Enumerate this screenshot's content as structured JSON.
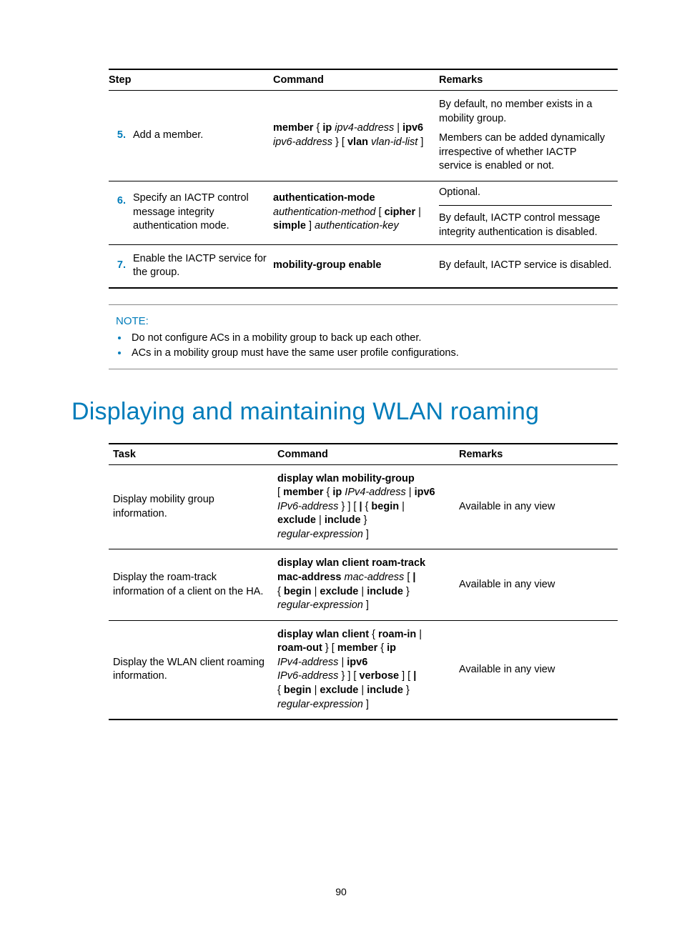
{
  "table1": {
    "headers": {
      "step": "Step",
      "command": "Command",
      "remarks": "Remarks"
    },
    "rows": [
      {
        "num": "5.",
        "desc": "Add a member.",
        "cmd": {
          "p1b": "member",
          "p1": " { ",
          "p2b": "ip",
          "p2i": " ipv4-address",
          "p3": " | ",
          "p3b": "ipv6",
          "p4i": "ipv6-address",
          "p4": " } [ ",
          "p5b": "vlan",
          "p5i": " vlan-id-list",
          "p6": " ]"
        },
        "rem1": "By default, no member exists in a mobility group.",
        "rem2": "Members can be added dynamically irrespective of whether IACTP service is enabled or not."
      },
      {
        "num": "6.",
        "desc": "Specify an IACTP control message integrity authentication mode.",
        "cmd": {
          "l1b": "authentication-mode",
          "l2i": "authentication-method",
          "l2": " [ ",
          "l2b1": "cipher",
          "l2s": " | ",
          "l3b": "simple",
          "l3": " ] ",
          "l3i": "authentication-key"
        },
        "rem_top": "Optional.",
        "rem_bot": "By default, IACTP control message integrity authentication is disabled."
      },
      {
        "num": "7.",
        "desc": "Enable the IACTP service for the group.",
        "cmd": {
          "b": "mobility-group enable"
        },
        "rem": "By default, IACTP service is disabled."
      }
    ]
  },
  "note": {
    "label": "NOTE:",
    "items": [
      "Do not configure ACs in a mobility group to back up each other.",
      "ACs in a mobility group must have the same user profile configurations."
    ]
  },
  "heading": "Displaying and maintaining WLAN roaming",
  "table2": {
    "headers": {
      "task": "Task",
      "command": "Command",
      "remarks": "Remarks"
    },
    "rows": [
      {
        "task": "Display mobility group information.",
        "cmd": {
          "l1b": "display wlan mobility-group",
          "l2a": "[ ",
          "l2b1": "member",
          "l2b": " { ",
          "l2b2": "ip",
          "l2i1": " IPv4-address",
          "l2c": " | ",
          "l2b3": "ipv6",
          "l3i": "IPv6-address",
          "l3a": " } ] [ ",
          "l3b1": "|",
          "l3b": " { ",
          "l3b2": "begin",
          "l3c": " |",
          "l4b1": "exclude",
          "l4a": " | ",
          "l4b2": "include",
          "l4b": " }",
          "l5i": "regular-expression",
          "l5a": " ]"
        },
        "rem": "Available in any view"
      },
      {
        "task": "Display the roam-track information of a client on the HA.",
        "cmd": {
          "l1b": "display wlan client roam-track",
          "l2b": "mac-address",
          "l2i": " mac-address",
          "l2a": " [ ",
          "l2b2": "|",
          "l3a": "{ ",
          "l3b1": "begin",
          "l3b": " | ",
          "l3b2": "exclude",
          "l3c": " | ",
          "l3b3": "include",
          "l3d": " }",
          "l4i": "regular-expression",
          "l4a": " ]"
        },
        "rem": "Available in any view"
      },
      {
        "task": "Display the WLAN client roaming information.",
        "cmd": {
          "l1b": "display wlan client",
          "l1a": " { ",
          "l1b2": "roam-in",
          "l1c": " |",
          "l2b1": "roam-out",
          "l2a": " } [ ",
          "l2b2": "member",
          "l2b": " { ",
          "l2b3": "ip",
          "l3i": "IPv4-address ",
          "l3a": " | ",
          "l3b": "ipv6",
          "l4i": "IPv6-address",
          "l4a": " } ] [ ",
          "l4b": "verbose",
          "l4b2": " ] [ ",
          "l4b3": "|",
          "l5a": "{ ",
          "l5b1": "begin",
          "l5b": " | ",
          "l5b2": "exclude",
          "l5c": " | ",
          "l5b3": "include",
          "l5d": " }",
          "l6i": "regular-expression",
          "l6a": " ]"
        },
        "rem": "Available in any view"
      }
    ]
  },
  "pagenum": "90"
}
